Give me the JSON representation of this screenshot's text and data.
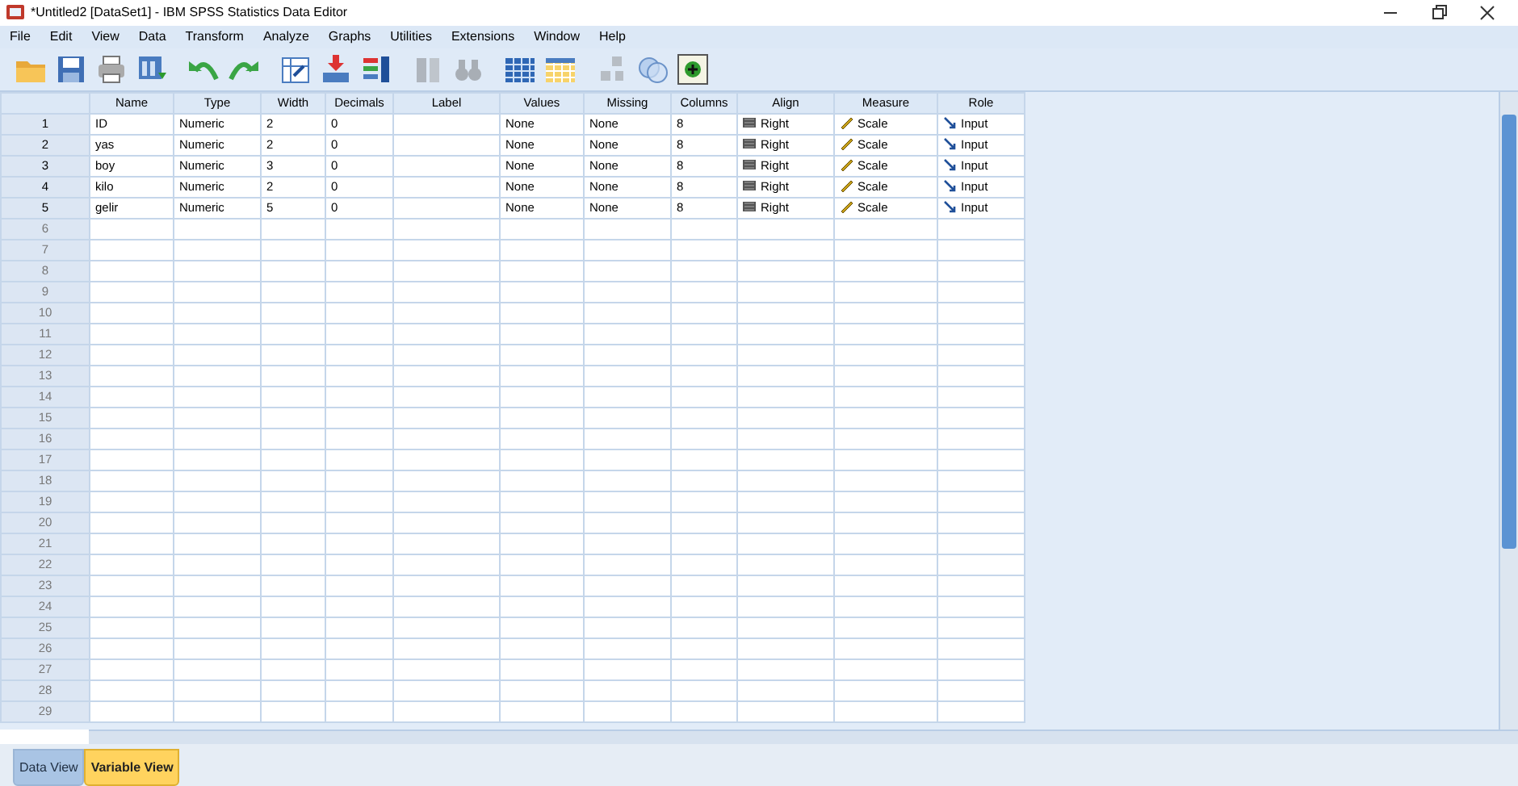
{
  "window": {
    "title": "*Untitled2 [DataSet1] - IBM SPSS Statistics Data Editor"
  },
  "menu": [
    "File",
    "Edit",
    "View",
    "Data",
    "Transform",
    "Analyze",
    "Graphs",
    "Utilities",
    "Extensions",
    "Window",
    "Help"
  ],
  "toolbar": [
    {
      "kind": "folder",
      "disabled": false
    },
    {
      "kind": "save",
      "disabled": false
    },
    {
      "kind": "print",
      "disabled": false
    },
    {
      "kind": "import",
      "disabled": false
    },
    {
      "kind": "undo",
      "disabled": false
    },
    {
      "kind": "redo",
      "disabled": false
    },
    {
      "kind": "goto",
      "disabled": false
    },
    {
      "kind": "insert",
      "disabled": false
    },
    {
      "kind": "bars",
      "disabled": false
    },
    {
      "kind": "split",
      "disabled": true
    },
    {
      "kind": "find",
      "disabled": true
    },
    {
      "kind": "grid",
      "disabled": false
    },
    {
      "kind": "table",
      "disabled": false
    },
    {
      "kind": "squares",
      "disabled": true
    },
    {
      "kind": "circles",
      "disabled": false
    },
    {
      "kind": "plus",
      "disabled": false
    }
  ],
  "table": {
    "columns": [
      "Name",
      "Type",
      "Width",
      "Decimals",
      "Label",
      "Values",
      "Missing",
      "Columns",
      "Align",
      "Measure",
      "Role"
    ],
    "rows": [
      {
        "number": "1",
        "cells": [
          "ID",
          "Numeric",
          "2",
          "0",
          "",
          "None",
          "None",
          "8",
          "Right",
          "Scale",
          "Input"
        ]
      },
      {
        "number": "2",
        "cells": [
          "yas",
          "Numeric",
          "2",
          "0",
          "",
          "None",
          "None",
          "8",
          "Right",
          "Scale",
          "Input"
        ]
      },
      {
        "number": "3",
        "cells": [
          "boy",
          "Numeric",
          "3",
          "0",
          "",
          "None",
          "None",
          "8",
          "Right",
          "Scale",
          "Input"
        ]
      },
      {
        "number": "4",
        "cells": [
          "kilo",
          "Numeric",
          "2",
          "0",
          "",
          "None",
          "None",
          "8",
          "Right",
          "Scale",
          "Input"
        ]
      },
      {
        "number": "5",
        "cells": [
          "gelir",
          "Numeric",
          "5",
          "0",
          "",
          "None",
          "None",
          "8",
          "Right",
          "Scale",
          "Input"
        ]
      },
      {
        "number": "6",
        "cells": []
      },
      {
        "number": "7",
        "cells": []
      },
      {
        "number": "8",
        "cells": []
      },
      {
        "number": "9",
        "cells": []
      },
      {
        "number": "10",
        "cells": []
      },
      {
        "number": "11",
        "cells": []
      },
      {
        "number": "12",
        "cells": []
      },
      {
        "number": "13",
        "cells": []
      },
      {
        "number": "14",
        "cells": []
      },
      {
        "number": "15",
        "cells": []
      },
      {
        "number": "16",
        "cells": []
      },
      {
        "number": "17",
        "cells": []
      },
      {
        "number": "18",
        "cells": []
      },
      {
        "number": "19",
        "cells": []
      },
      {
        "number": "20",
        "cells": []
      },
      {
        "number": "21",
        "cells": []
      },
      {
        "number": "22",
        "cells": []
      },
      {
        "number": "23",
        "cells": []
      },
      {
        "number": "24",
        "cells": []
      },
      {
        "number": "25",
        "cells": []
      },
      {
        "number": "26",
        "cells": []
      },
      {
        "number": "27",
        "cells": []
      },
      {
        "number": "28",
        "cells": []
      },
      {
        "number": "29",
        "cells": []
      }
    ]
  },
  "view_tabs": [
    {
      "label": "Data View",
      "selected": false
    },
    {
      "label": "Variable View",
      "selected": true
    }
  ]
}
